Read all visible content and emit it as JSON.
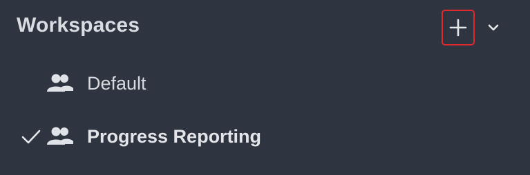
{
  "workspaces": {
    "title": "Workspaces",
    "add_icon": "plus-icon",
    "collapse_icon": "chevron-down-icon",
    "items": [
      {
        "label": "Default",
        "icon": "group-icon",
        "selected": false
      },
      {
        "label": "Progress Reporting",
        "icon": "group-icon",
        "selected": true
      }
    ]
  },
  "colors": {
    "background": "#2f3540",
    "text": "#d9dce1",
    "highlight_border": "#e0282d"
  }
}
